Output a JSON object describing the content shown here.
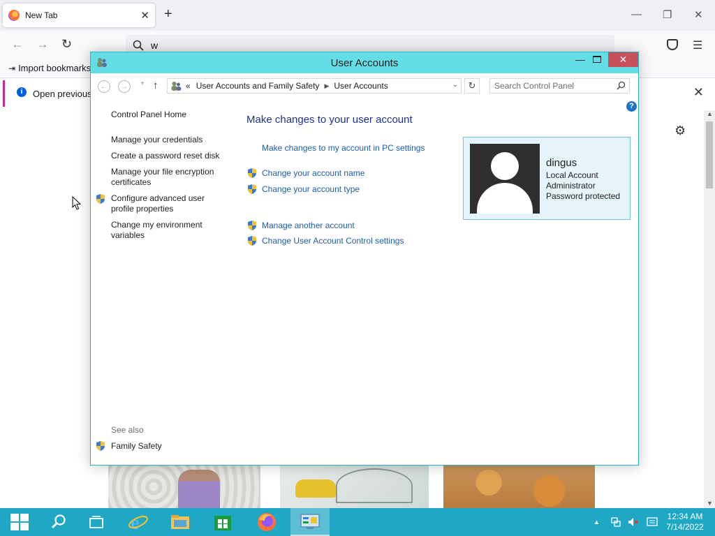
{
  "browser": {
    "tab_title": "New Tab",
    "url_text": "w",
    "bookmarks_import": "Import bookmarks...",
    "info_bar_text": "Open previous t"
  },
  "window": {
    "title": "User Accounts",
    "breadcrumb": {
      "prefix": "«",
      "items": [
        "User Accounts and Family Safety",
        "User Accounts"
      ]
    },
    "search_placeholder": "Search Control Panel",
    "help_label": "?"
  },
  "sidebar": {
    "home": "Control Panel Home",
    "links": [
      {
        "label": "Manage your credentials",
        "shield": false
      },
      {
        "label": "Create a password reset disk",
        "shield": false
      },
      {
        "label": "Manage your file encryption certificates",
        "shield": false
      },
      {
        "label": "Configure advanced user profile properties",
        "shield": true
      },
      {
        "label": "Change my environment variables",
        "shield": false
      }
    ],
    "see_also_label": "See also",
    "see_also_links": [
      {
        "label": "Family Safety",
        "shield": true
      }
    ]
  },
  "main": {
    "heading": "Make changes to your user account",
    "links": [
      {
        "label": "Make changes to my account in PC settings",
        "shield": false
      },
      {
        "label": "Change your account name",
        "shield": true
      },
      {
        "label": "Change your account type",
        "shield": true
      },
      {
        "label": "Manage another account",
        "shield": true
      },
      {
        "label": "Change User Account Control settings",
        "shield": true
      }
    ]
  },
  "account": {
    "name": "dingus",
    "type": "Local Account",
    "role": "Administrator",
    "status": "Password protected"
  },
  "taskbar": {
    "items": [
      "start-button",
      "search-icon",
      "task-view-icon",
      "internet-explorer-icon",
      "file-explorer-icon",
      "store-icon",
      "firefox-icon",
      "control-panel-icon"
    ],
    "active_item": "control-panel-icon",
    "time": "12:34 AM",
    "date": "7/14/2022"
  },
  "colors": {
    "titlebar": "#63dde6",
    "taskbar": "#20a7c4",
    "link": "#1e5da8",
    "heading": "#1e3287",
    "close_button": "#c7505a",
    "account_card_bg": "#e5f3fb",
    "account_card_border": "#70c0e7"
  }
}
